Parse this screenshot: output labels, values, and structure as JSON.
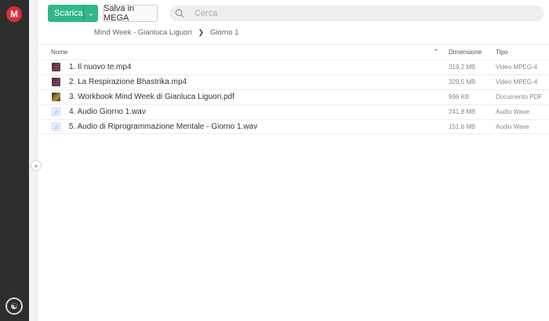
{
  "sidebar": {
    "logo_letter": "M"
  },
  "toolbar": {
    "download_label": "Scarica",
    "save_label": "Salva in MEGA"
  },
  "search": {
    "placeholder": "Cerca"
  },
  "breadcrumb": {
    "folder": "Mind Week - Gianluca Liguori",
    "current": "Giorno 1"
  },
  "table": {
    "headers": {
      "name": "Nome",
      "size": "Dimensione",
      "type": "Tipo"
    },
    "rows": [
      {
        "name": "1. Il nuovo te.mp4",
        "size": "319,2 MB",
        "type": "Video MPEG-4",
        "icon": "video-thumbnail-icon"
      },
      {
        "name": "2. La Respirazione Bhastrika.mp4",
        "size": "329,5 MB",
        "type": "Video MPEG-4",
        "icon": "video-thumbnail-icon"
      },
      {
        "name": "3. Workbook Mind Week di Gianluca Liguori.pdf",
        "size": "996 KB",
        "type": "Documento PDF",
        "icon": "pdf-thumbnail-icon"
      },
      {
        "name": "4. Audio Giorno 1.wav",
        "size": "241,8 MB",
        "type": "Audio Wave",
        "icon": "audio-file-icon"
      },
      {
        "name": "5. Audio di Riprogrammazione Mentale - Giorno 1.wav",
        "size": "151,6 MB",
        "type": "Audio Wave",
        "icon": "audio-file-icon"
      }
    ]
  },
  "colors": {
    "brand": "#e02a3a",
    "accent": "#31b78a",
    "rail": "#2e2e2e"
  }
}
